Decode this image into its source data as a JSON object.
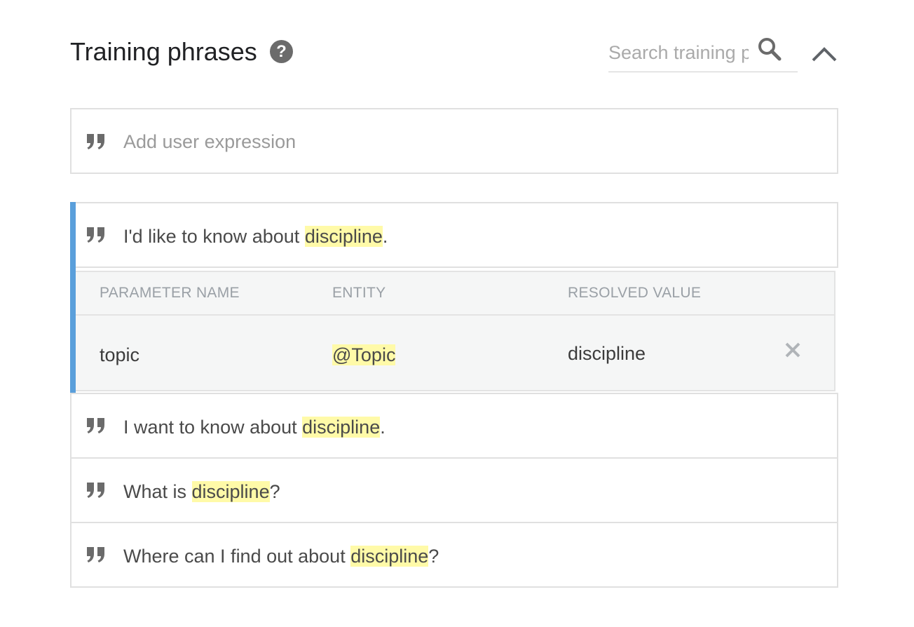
{
  "header": {
    "title": "Training phrases",
    "help_icon": "question-circle-icon",
    "search_placeholder": "Search training phrases",
    "search_icon": "search-icon",
    "collapse_icon": "chevron-up-icon"
  },
  "add_expression": {
    "placeholder": "Add user expression",
    "icon": "quote-icon"
  },
  "phrases": [
    {
      "prefix": "I'd like to know about ",
      "entity": "discipline",
      "suffix": "."
    },
    {
      "prefix": "I want to know about ",
      "entity": "discipline",
      "suffix": "."
    },
    {
      "prefix": "What is ",
      "entity": "discipline",
      "suffix": "?"
    },
    {
      "prefix": "Where can I find out about ",
      "entity": "discipline",
      "suffix": "?"
    }
  ],
  "parameter_table": {
    "columns": [
      "PARAMETER NAME",
      "ENTITY",
      "RESOLVED VALUE"
    ],
    "rows": [
      {
        "parameter_name": "topic",
        "entity": "@Topic",
        "resolved_value": "discipline"
      }
    ]
  },
  "colors": {
    "highlight": "#fffaa8",
    "active_bar": "#5a9fdb",
    "icon_gray": "#6b6b6b"
  }
}
